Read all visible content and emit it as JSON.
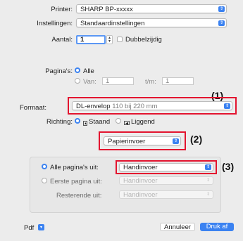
{
  "printer": {
    "label": "Printer:",
    "value": "SHARP BP-xxxxx"
  },
  "presets": {
    "label": "Instellingen:",
    "value": "Standaardinstellingen"
  },
  "copies": {
    "label": "Aantal:",
    "value": "1",
    "duplex_label": "Dubbelzijdig"
  },
  "pages": {
    "label": "Pagina's:",
    "all_label": "Alle",
    "from_label": "Van:",
    "from_value": "1",
    "to_label": "t/m:",
    "to_value": "1"
  },
  "paper_size": {
    "label": "Formaat:",
    "value": "DL-envelop",
    "detail": "110 bij 220 mm"
  },
  "orientation": {
    "label": "Richting:",
    "portrait": "Staand",
    "landscape": "Liggend"
  },
  "panel_menu": {
    "value": "Papierinvoer"
  },
  "paper_feed": {
    "all_pages_label": "Alle pagina's uit:",
    "all_pages_value": "Handinvoer",
    "first_page_label": "Eerste pagina uit:",
    "first_page_value": "Handinvoer",
    "remaining_label": "Resterende uit:",
    "remaining_value": "Handinvoer"
  },
  "footer": {
    "pdf": "Pdf",
    "cancel": "Annuleer",
    "print": "Druk af"
  },
  "callouts": {
    "c1": "(1)",
    "c2": "(2)",
    "c3": "(3)"
  },
  "colors": {
    "accent": "#3b82f1",
    "callout": "#e3142f"
  }
}
